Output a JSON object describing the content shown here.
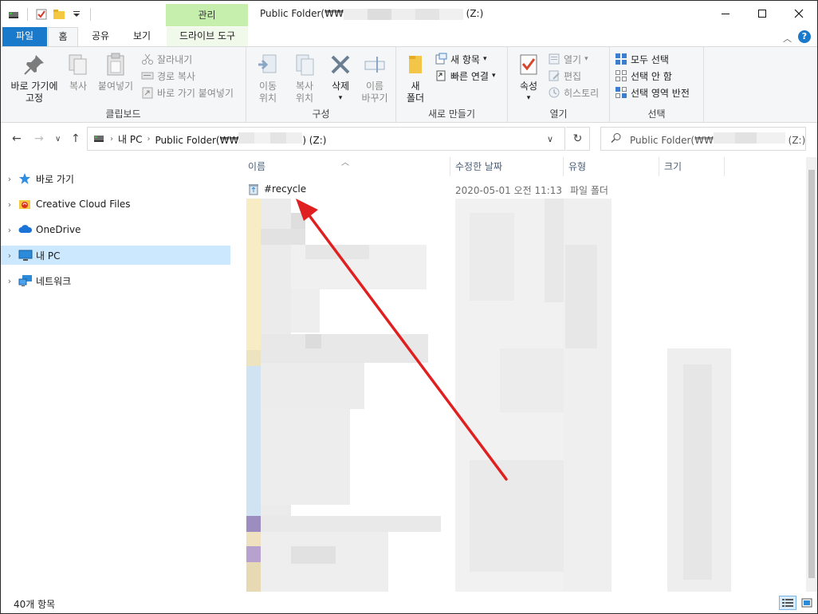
{
  "window": {
    "title_prefix": "Public Folder(₩₩",
    "title_suffix": "(Z:)",
    "manage_tab": "관리",
    "minimize": "—",
    "maximize": "☐",
    "close": "✕"
  },
  "ribbon_tabs": {
    "file": "파일",
    "home": "홈",
    "share": "공유",
    "view": "보기",
    "drive_tools": "드라이브 도구"
  },
  "ribbon": {
    "clipboard": {
      "label": "클립보드",
      "pin_line1": "바로 가기에",
      "pin_line2": "고정",
      "copy": "복사",
      "paste": "붙여넣기",
      "cut": "잘라내기",
      "copy_path": "경로 복사",
      "paste_shortcut": "바로 가기 붙여넣기"
    },
    "organize": {
      "label": "구성",
      "move_line1": "이동",
      "move_line2": "위치",
      "copy_line1": "복사",
      "copy_line2": "위치",
      "delete": "삭제",
      "rename_line1": "이름",
      "rename_line2": "바꾸기"
    },
    "new": {
      "label": "새로 만들기",
      "folder_line1": "새",
      "folder_line2": "폴더",
      "new_item": "새 항목",
      "easy_access": "빠른 연결"
    },
    "open": {
      "label": "열기",
      "properties": "속성",
      "open": "열기",
      "edit": "편집",
      "history": "히스토리"
    },
    "select": {
      "label": "선택",
      "select_all": "모두 선택",
      "select_none": "선택 안 함",
      "invert": "선택 영역 반전"
    }
  },
  "address": {
    "this_pc": "내 PC",
    "folder_prefix": "Public Folder(₩₩",
    "folder_suffix": ") (Z:)",
    "search_prefix": "Public Folder(₩₩",
    "search_suffix": "(Z:) ..."
  },
  "nav_pane": {
    "quick_access": "바로 가기",
    "creative_cloud": "Creative Cloud Files",
    "onedrive": "OneDrive",
    "this_pc": "내 PC",
    "network": "네트워크"
  },
  "columns": {
    "name": "이름",
    "date": "수정한 날짜",
    "type": "유형",
    "size": "크기"
  },
  "files": [
    {
      "name": "#recycle",
      "date": "2020-05-01 오전 11:13",
      "type": "파일 폴더",
      "size": ""
    }
  ],
  "annotation": {
    "color": "#e02020"
  },
  "status": {
    "item_count": "40개 항목"
  },
  "colors": {
    "file_tab": "#1979ca",
    "manage_tab": "#c6efad",
    "selection": "#cce8ff"
  }
}
